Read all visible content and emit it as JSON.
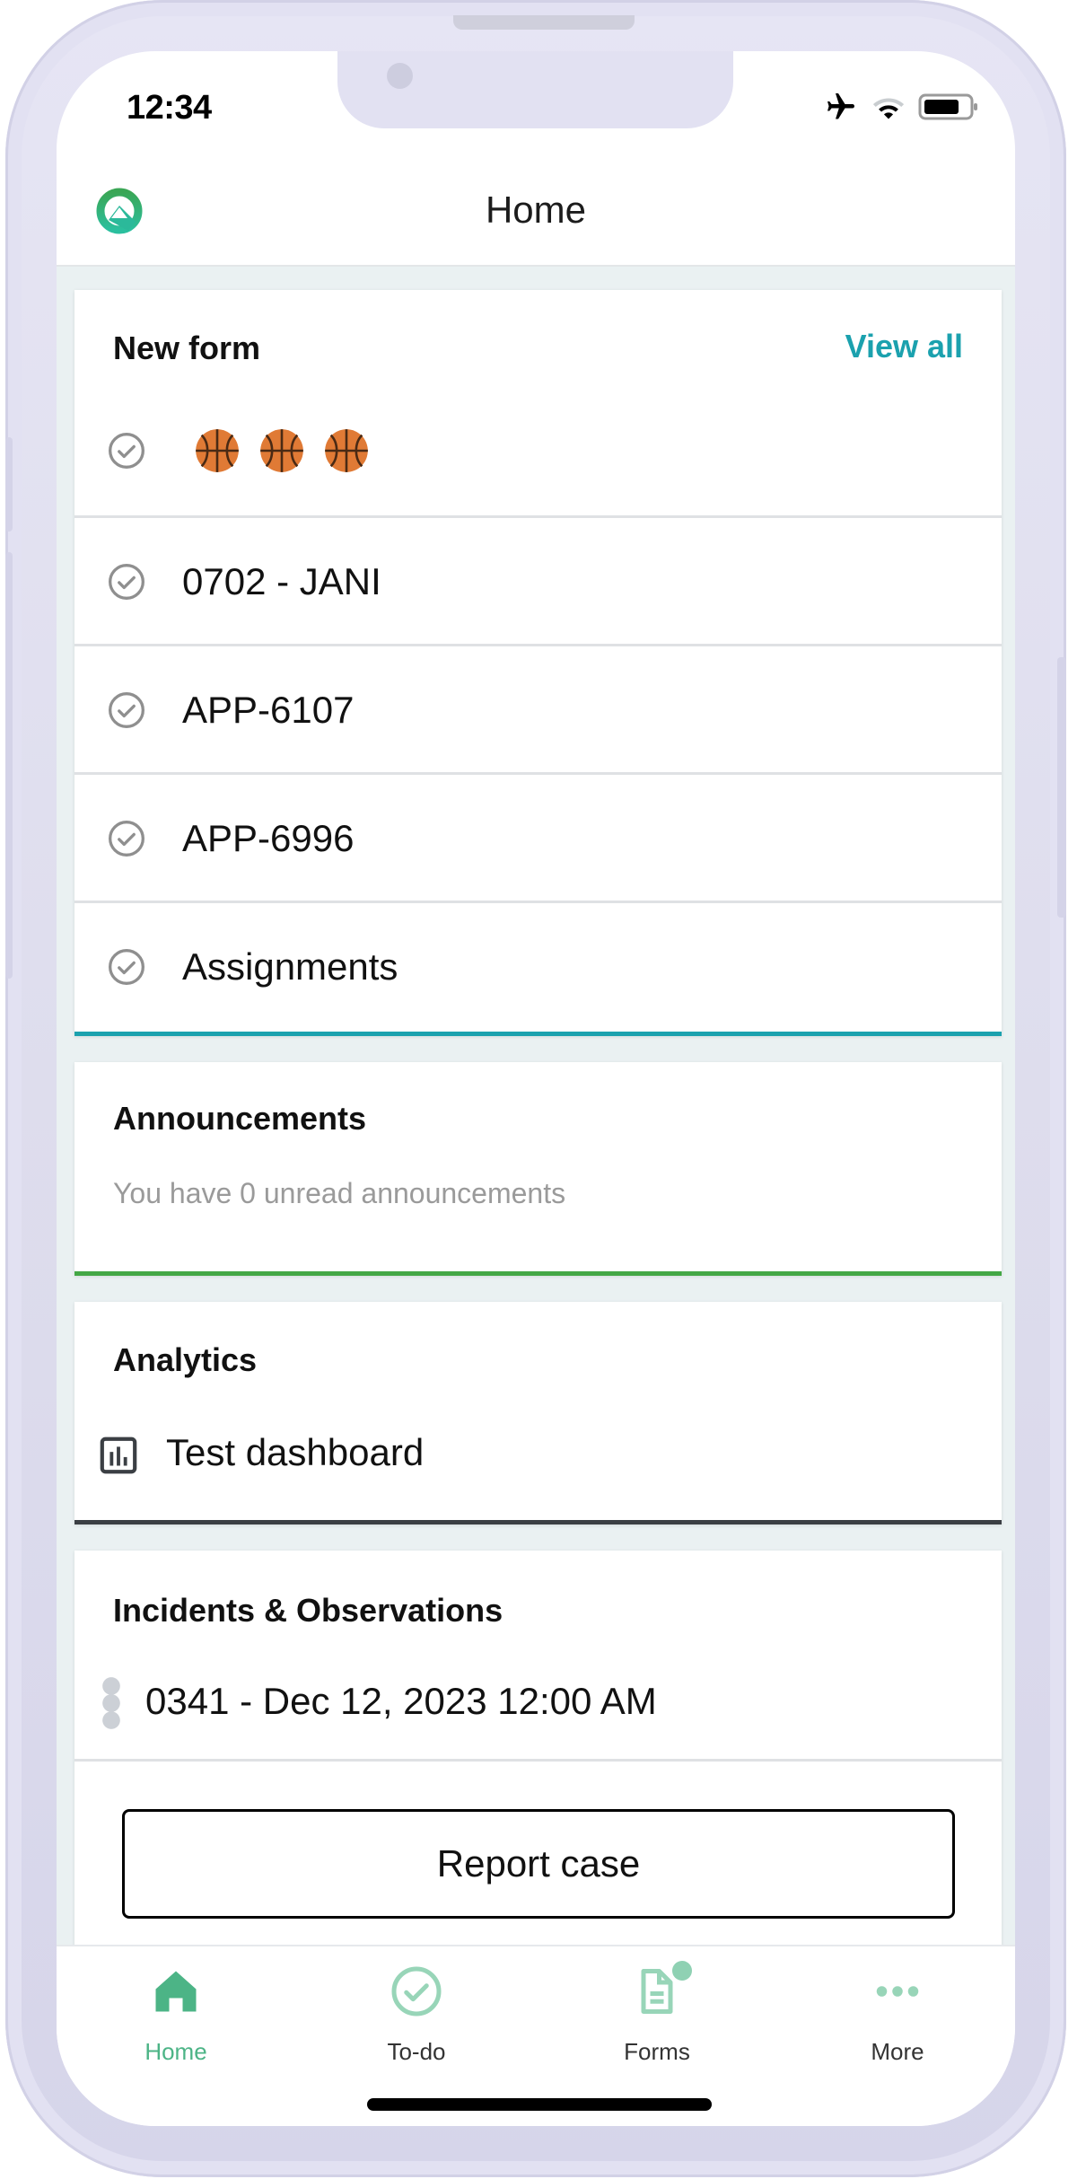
{
  "status_bar": {
    "time": "12:34",
    "icons": [
      "airplane-mode-icon",
      "wifi-icon",
      "battery-icon"
    ]
  },
  "header": {
    "logo": "app-logo",
    "title": "Home"
  },
  "colors": {
    "accent_teal": "#1ba1ae",
    "accent_green": "#4cb486",
    "announcements_border": "#43a745",
    "analytics_border": "#3b3f44",
    "content_bg": "#eaf1f2",
    "phone_frame": "#e0dff0"
  },
  "cards": {
    "new_form": {
      "title": "New form",
      "view_all": "View all",
      "items": [
        {
          "label": "🏀🏀🏀",
          "icon": "check-circle-icon"
        },
        {
          "label": "0702 - JANI",
          "icon": "check-circle-icon"
        },
        {
          "label": "APP-6107",
          "icon": "check-circle-icon"
        },
        {
          "label": "APP-6996",
          "icon": "check-circle-icon"
        },
        {
          "label": "Assignments",
          "icon": "check-circle-icon"
        }
      ]
    },
    "announcements": {
      "title": "Announcements",
      "message": "You have 0 unread announcements"
    },
    "analytics": {
      "title": "Analytics",
      "items": [
        {
          "label": "Test dashboard",
          "icon": "bar-chart-icon"
        }
      ]
    },
    "incidents": {
      "title": "Incidents & Observations",
      "items": [
        {
          "label": "0341 - Dec 12, 2023 12:00 AM",
          "icon": "status-dots-icon"
        }
      ],
      "report_button": "Report case"
    }
  },
  "bottom_nav": {
    "items": [
      {
        "label": "Home",
        "icon": "home-icon",
        "active": true
      },
      {
        "label": "To-do",
        "icon": "check-circle-icon",
        "active": false
      },
      {
        "label": "Forms",
        "icon": "document-icon",
        "active": false,
        "badge": true
      },
      {
        "label": "More",
        "icon": "more-dots-icon",
        "active": false
      }
    ]
  }
}
